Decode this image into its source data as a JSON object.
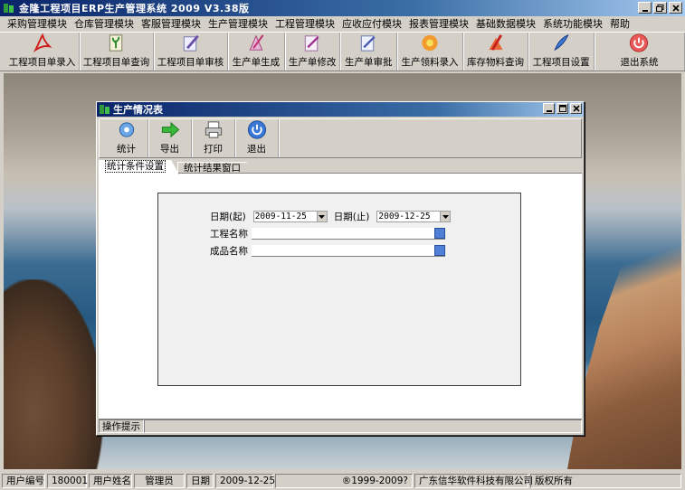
{
  "app": {
    "title": "金隆工程项目ERP生产管理系统 2009 V3.38版"
  },
  "menu": [
    "采购管理模块",
    "仓库管理模块",
    "客服管理模块",
    "生产管理模块",
    "工程管理模块",
    "应收应付模块",
    "报表管理模块",
    "基础数据模块",
    "系统功能模块",
    "帮助"
  ],
  "toolbar": {
    "t0": "工程项目单录入",
    "t1": "工程项目单查询",
    "t2": "工程项目单审核",
    "t3": "生产单生成",
    "t4": "生产单修改",
    "t5": "生产单审批",
    "t6": "生产领料录入",
    "t7": "库存物料查询",
    "t8": "工程项目设置",
    "t9": "退出系统"
  },
  "child": {
    "title": "生产情况表",
    "toolbar": {
      "stats": "统计",
      "export": "导出",
      "print": "打印",
      "exit": "退出"
    },
    "tabs": {
      "conditions": "统计条件设置",
      "results": "统计结果窗口"
    },
    "form": {
      "date_from_label": "日期(起)",
      "date_from": "2009-11-25",
      "date_to_label": "日期(止)",
      "date_to": "2009-12-25",
      "project_label": "工程名称",
      "project_value": "",
      "product_label": "成品名称",
      "product_value": ""
    },
    "hint": "操作提示"
  },
  "status": {
    "user_id_label": "用户编号",
    "user_id": "180001",
    "user_name_label": "用户姓名",
    "user_name": "管理员",
    "date_label": "日期",
    "date": "2009-12-25",
    "copyright": "®1999-2009?",
    "company": "广东信华软件科技有限公司",
    "rights": "版权所有"
  }
}
